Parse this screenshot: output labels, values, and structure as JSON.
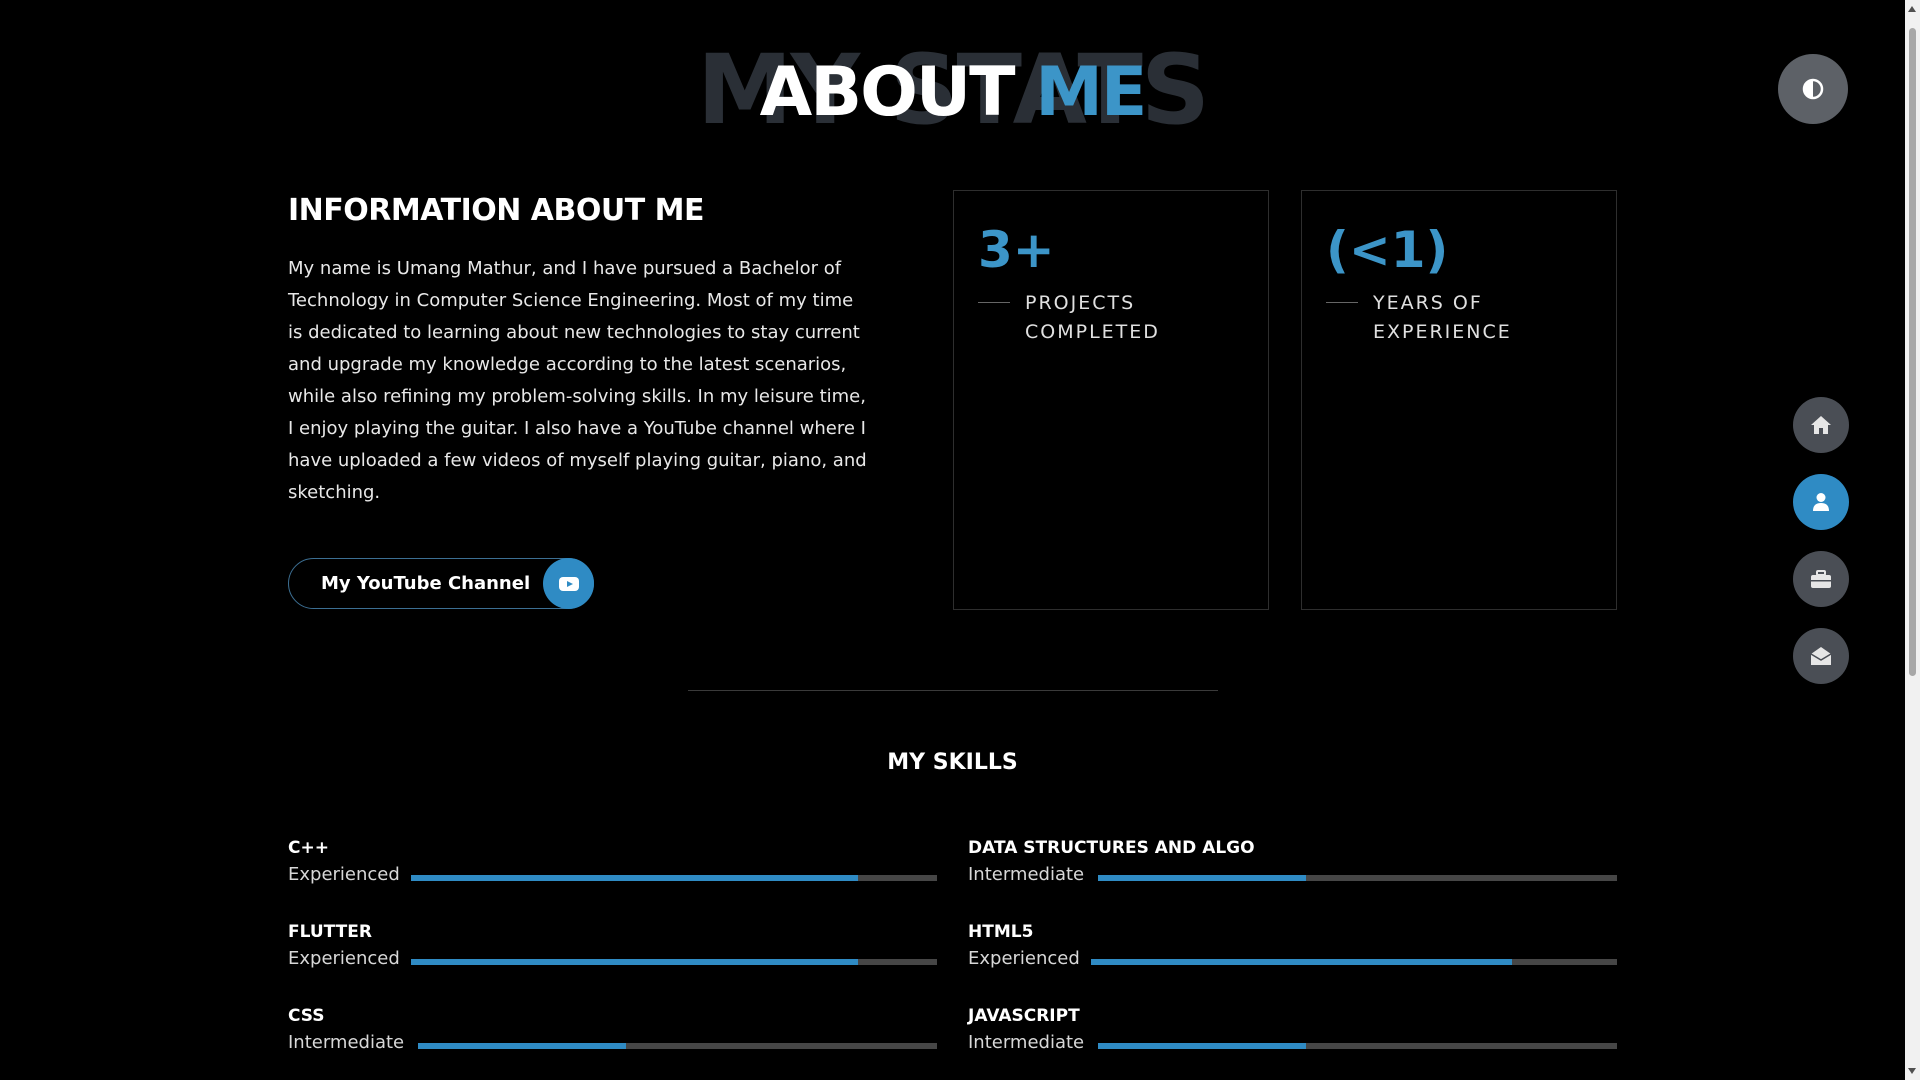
{
  "heading": {
    "background_word": "MY STATS",
    "title_main": "ABOUT",
    "title_accent": "ME"
  },
  "info": {
    "title": "INFORMATION ABOUT ME",
    "paragraph": "My name is Umang Mathur, and I have pursued a Bachelor of Technology in Computer Science Engineering. Most of my time is dedicated to learning about new technologies to stay current and upgrade my knowledge according to the latest scenarios, while also refining my problem-solving skills. In my leisure time, I enjoy playing the guitar. I also have a YouTube channel where I have uploaded a few videos of myself playing guitar, piano, and sketching.",
    "youtube_button": "My YouTube Channel"
  },
  "stats": [
    {
      "number": "3+",
      "label_line1": "PROJECTS",
      "label_line2": "COMPLETED"
    },
    {
      "number": "(<1)",
      "label_line1": "YEARS OF",
      "label_line2": "EXPERIENCE"
    }
  ],
  "skills": {
    "title": "MY SKILLS",
    "items": [
      {
        "name": "C++",
        "level": "Experienced",
        "fill_percent": 85
      },
      {
        "name": "DATA STRUCTURES AND ALGO",
        "level": "Intermediate",
        "fill_percent": 40
      },
      {
        "name": "FLUTTER",
        "level": "Experienced",
        "fill_percent": 85
      },
      {
        "name": "HTML5",
        "level": "Experienced",
        "fill_percent": 80
      },
      {
        "name": "CSS",
        "level": "Intermediate",
        "fill_percent": 40
      },
      {
        "name": "JAVASCRIPT",
        "level": "Intermediate",
        "fill_percent": 40
      }
    ]
  },
  "colors": {
    "accent": "#2f8bc4",
    "background": "#000000",
    "nav_button": "#4a4e55",
    "bar_track": "#464646"
  },
  "icons": {
    "theme_toggle": "half-circle-contrast-icon",
    "nav": [
      "home-icon",
      "user-icon",
      "briefcase-icon",
      "envelope-open-icon"
    ],
    "youtube": "youtube-icon"
  }
}
